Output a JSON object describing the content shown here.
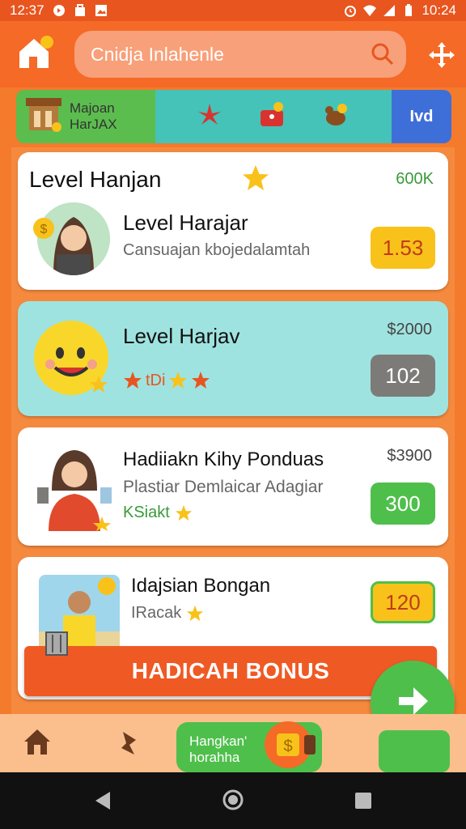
{
  "status_bar": {
    "time_left": "12:37",
    "time_right": "10:24"
  },
  "header": {
    "search_placeholder": "Cnidja Inlahenle"
  },
  "category_strip": {
    "left_label": "Majoan\nHarJAX",
    "right_label": "Ivd"
  },
  "main": {
    "title": "Level Hanjan",
    "title_value": "600K",
    "cards": [
      {
        "title": "Level Harajar",
        "subtitle": "Cansuajan kbojedalamtah",
        "value": "1.53",
        "pill_color": "#f8c21a"
      },
      {
        "title": "Level Harjav",
        "subtitle": "",
        "tag": "tDi",
        "corner": "$2000",
        "value": "102",
        "pill_color": "#7d7b78"
      },
      {
        "title": "Hadiiakn Kihy Ponduas",
        "subtitle": "Plastiar Demlaicar Adagiar",
        "tag": "KSiakt",
        "corner": "$3900",
        "value": "300",
        "pill_color": "#4fbf4c"
      },
      {
        "title": "Idajsian Bongan",
        "subtitle": "",
        "tag": "IRacak",
        "value": "120",
        "pill_color": "#f8c21a"
      }
    ]
  },
  "bonus_banner": {
    "label": "HADICAH BONUS"
  },
  "bottom_nav": {
    "promo_label": "Hangkan'\nhorahha"
  },
  "colors": {
    "accent": "#f46a26",
    "green": "#4fbf4c",
    "yellow": "#f8c21a",
    "teal": "#9fe3e0"
  }
}
